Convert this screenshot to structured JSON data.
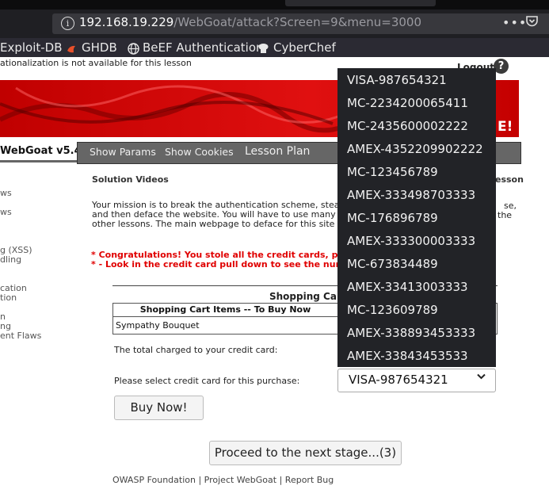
{
  "browser": {
    "url_host": "192.168.19.229",
    "url_path": "/WebGoat/attack?Screen=9&menu=3000",
    "more": "•••",
    "bookmarks": [
      "Exploit-DB",
      "GHDB",
      "BeEF Authentication",
      "CyberChef"
    ]
  },
  "page": {
    "i18n_notice": "ationalization is not available for this lesson",
    "logout": "Logout",
    "help": "?",
    "banner_text": "E!",
    "title": "WebGoat v5.4",
    "nav": [
      "Show Params",
      "Show Cookies",
      "Lesson Plan"
    ],
    "sidebar": [
      "ws",
      "ws",
      "g (XSS)",
      "dling",
      "cation",
      "tion",
      "n",
      "ng",
      "ent Flaws"
    ],
    "solution_videos": "Solution Videos",
    "lesson_right": "esson",
    "mission_lines": [
      "Your mission is to break the authentication scheme, steal",
      "and then deface the website. You will have to use many o",
      "other lessons. The main webpage to deface for this site i"
    ],
    "mission_right": [
      "se,",
      "the"
    ],
    "congrats_lines": [
      "* Congratulations! You stole all the credit cards, pr",
      "* - Look in the credit card pull down to see the num"
    ],
    "cart_title": "Shopping Car",
    "cart_header": "Shopping Cart Items -- To Buy Now",
    "cart_item": "Sympathy Bouquet",
    "total_label": "The total charged to your credit card:",
    "select_label": "Please select credit card for this purchase:",
    "selected_card": "VISA-987654321",
    "buy_button": "Buy Now!",
    "proceed_button": "Proceed to the next stage...(3)",
    "footer": "OWASP Foundation | Project WebGoat | Report Bug"
  },
  "dropdown_options": [
    "VISA-987654321",
    "MC-2234200065411",
    "MC-2435600002222",
    "AMEX-4352209902222",
    "MC-123456789",
    "AMEX-333498703333",
    "MC-176896789",
    "AMEX-333300003333",
    "MC-673834489",
    "AMEX-33413003333",
    "MC-123609789",
    "AMEX-338893453333",
    "AMEX-33843453533"
  ]
}
